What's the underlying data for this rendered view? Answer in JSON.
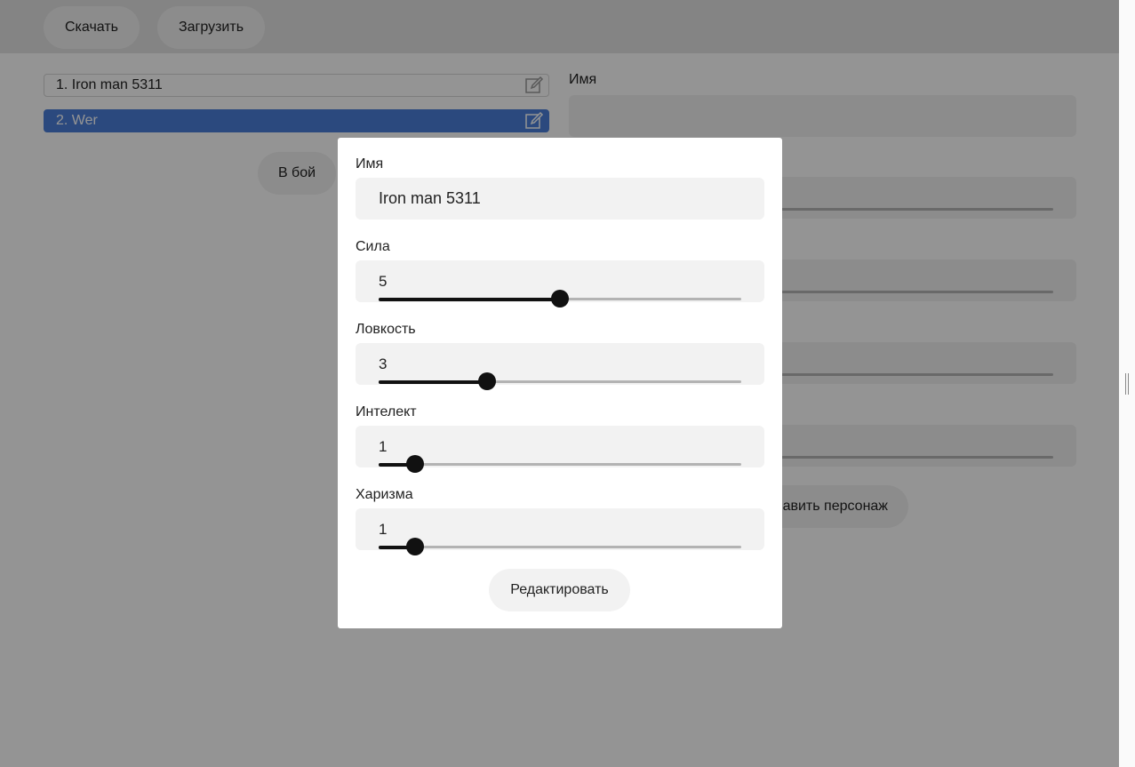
{
  "toolbar": {
    "download_label": "Скачать",
    "upload_label": "Загрузить"
  },
  "characters": [
    {
      "label": "1. Iron man 5311",
      "active": false
    },
    {
      "label": "2. Wer",
      "active": true
    }
  ],
  "fight_button_label": "В бой",
  "form": {
    "name_label": "Имя",
    "add_button_label": "Добавить персонаж",
    "add_button_visible_text": "авить персонаж"
  },
  "modal": {
    "name_label": "Имя",
    "name_value": "Iron man 5311",
    "stats": [
      {
        "label": "Сила",
        "value": "5",
        "fraction": 0.5
      },
      {
        "label": "Ловкость",
        "value": "3",
        "fraction": 0.3
      },
      {
        "label": "Интелект",
        "value": "1",
        "fraction": 0.1
      },
      {
        "label": "Харизма",
        "value": "1",
        "fraction": 0.1
      }
    ],
    "submit_label": "Редактировать"
  },
  "icons": {
    "edit": "pencil-square-icon"
  },
  "colors": {
    "accent": "#4a7fd9",
    "overlay": "rgba(0,0,0,0.42)"
  }
}
